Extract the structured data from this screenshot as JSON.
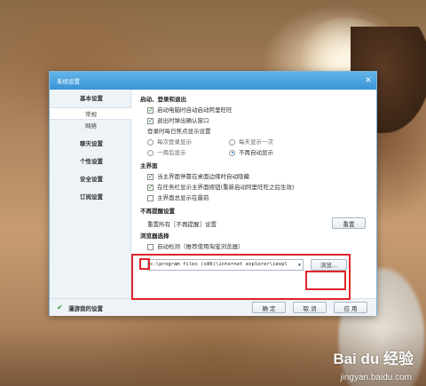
{
  "window": {
    "title": "系统设置",
    "close_icon": "close-icon"
  },
  "sidebar": {
    "items": [
      {
        "label": "基本设置",
        "type": "group"
      },
      {
        "label": "常规",
        "type": "sub",
        "active": true
      },
      {
        "label": "网络",
        "type": "sub"
      },
      {
        "label": "聊天设置",
        "type": "group"
      },
      {
        "label": "个性设置",
        "type": "group"
      },
      {
        "label": "安全设置",
        "type": "group"
      },
      {
        "label": "订阅设置",
        "type": "group"
      }
    ]
  },
  "startup": {
    "title": "启动、登录和退出",
    "auto_start": {
      "label": "启动电脑时自动启动阿里旺旺",
      "checked": true
    },
    "exit_confirm": {
      "label": "退出时弹出确认窗口",
      "checked": true
    },
    "focus_info": "登录时每日焦点显示设置",
    "radios": [
      {
        "label": "每次登录显示",
        "selected": false
      },
      {
        "label": "每天显示一次",
        "selected": false
      },
      {
        "label": "一周后显示",
        "selected": false
      },
      {
        "label": "不再自动显示",
        "selected": true
      }
    ]
  },
  "main_panel": {
    "title": "主界面",
    "options": [
      {
        "label": "当主界面停靠在桌面边缘时自动隐藏",
        "checked": true
      },
      {
        "label": "在任务栏显示主界面按钮(重新启动阿里旺旺之后生效)",
        "checked": true
      },
      {
        "label": "主界面总显示在最前",
        "checked": false
      }
    ]
  },
  "reminder": {
    "title": "不再提醒设置",
    "reset_text": "重置所有［不再提醒］设置",
    "reset_button": "重置"
  },
  "browser": {
    "title": "浏览器选择",
    "auto_detect": {
      "label": "自动检测（推荐使用淘宝浏览器）",
      "checked": false
    },
    "path": "c:\\program files (x86)\\internet explorer\\iexpl",
    "browse_button": "浏览..."
  },
  "footer": {
    "roam_label": "漫游我的设置",
    "ok": "确 定",
    "cancel": "取 消",
    "apply": "应 用"
  },
  "watermark": {
    "brand": "Bai du 经验",
    "url": "jingyan.baidu.com"
  }
}
